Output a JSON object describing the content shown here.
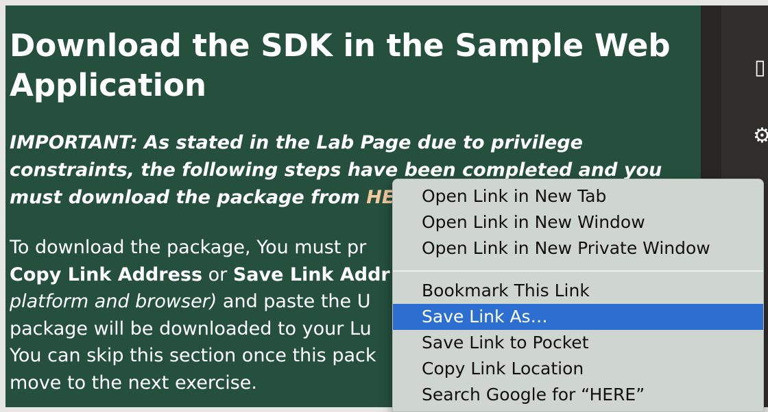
{
  "page": {
    "heading": "Download the SDK in the Sample Web Application",
    "important_prefix": "IMPORTANT: As stated in the Lab Page due to privilege constraints, the following steps have been completed and you must download the package from ",
    "important_link": "HERE",
    "para": {
      "t1": "To download the package, You must pr",
      "b1": "Copy Link Address",
      "t2": " or ",
      "b2": "Save Link Addr",
      "i1": "platform and browser)",
      "t3": " and paste the U",
      "t4": "package will be downloaded to your Lu",
      "t5": "You can skip this section once this pack",
      "t6": "move to the next exercise."
    }
  },
  "context_menu": {
    "items": [
      {
        "label": "Open Link in New Tab"
      },
      {
        "label": "Open Link in New Window"
      },
      {
        "label": "Open Link in New Private Window"
      },
      {
        "label": "Bookmark This Link"
      },
      {
        "label": "Save Link As…"
      },
      {
        "label": "Save Link to Pocket"
      },
      {
        "label": "Copy Link Location"
      },
      {
        "label": "Search Google for “HERE”"
      }
    ],
    "highlighted_index": 4,
    "highlight_color": "#2c6fd1"
  },
  "colors": {
    "content_bg": "#25503d",
    "link": "#f1c99e"
  },
  "icons": {
    "strip_top": "bookmark-icon",
    "strip_mid": "gear-icon"
  }
}
